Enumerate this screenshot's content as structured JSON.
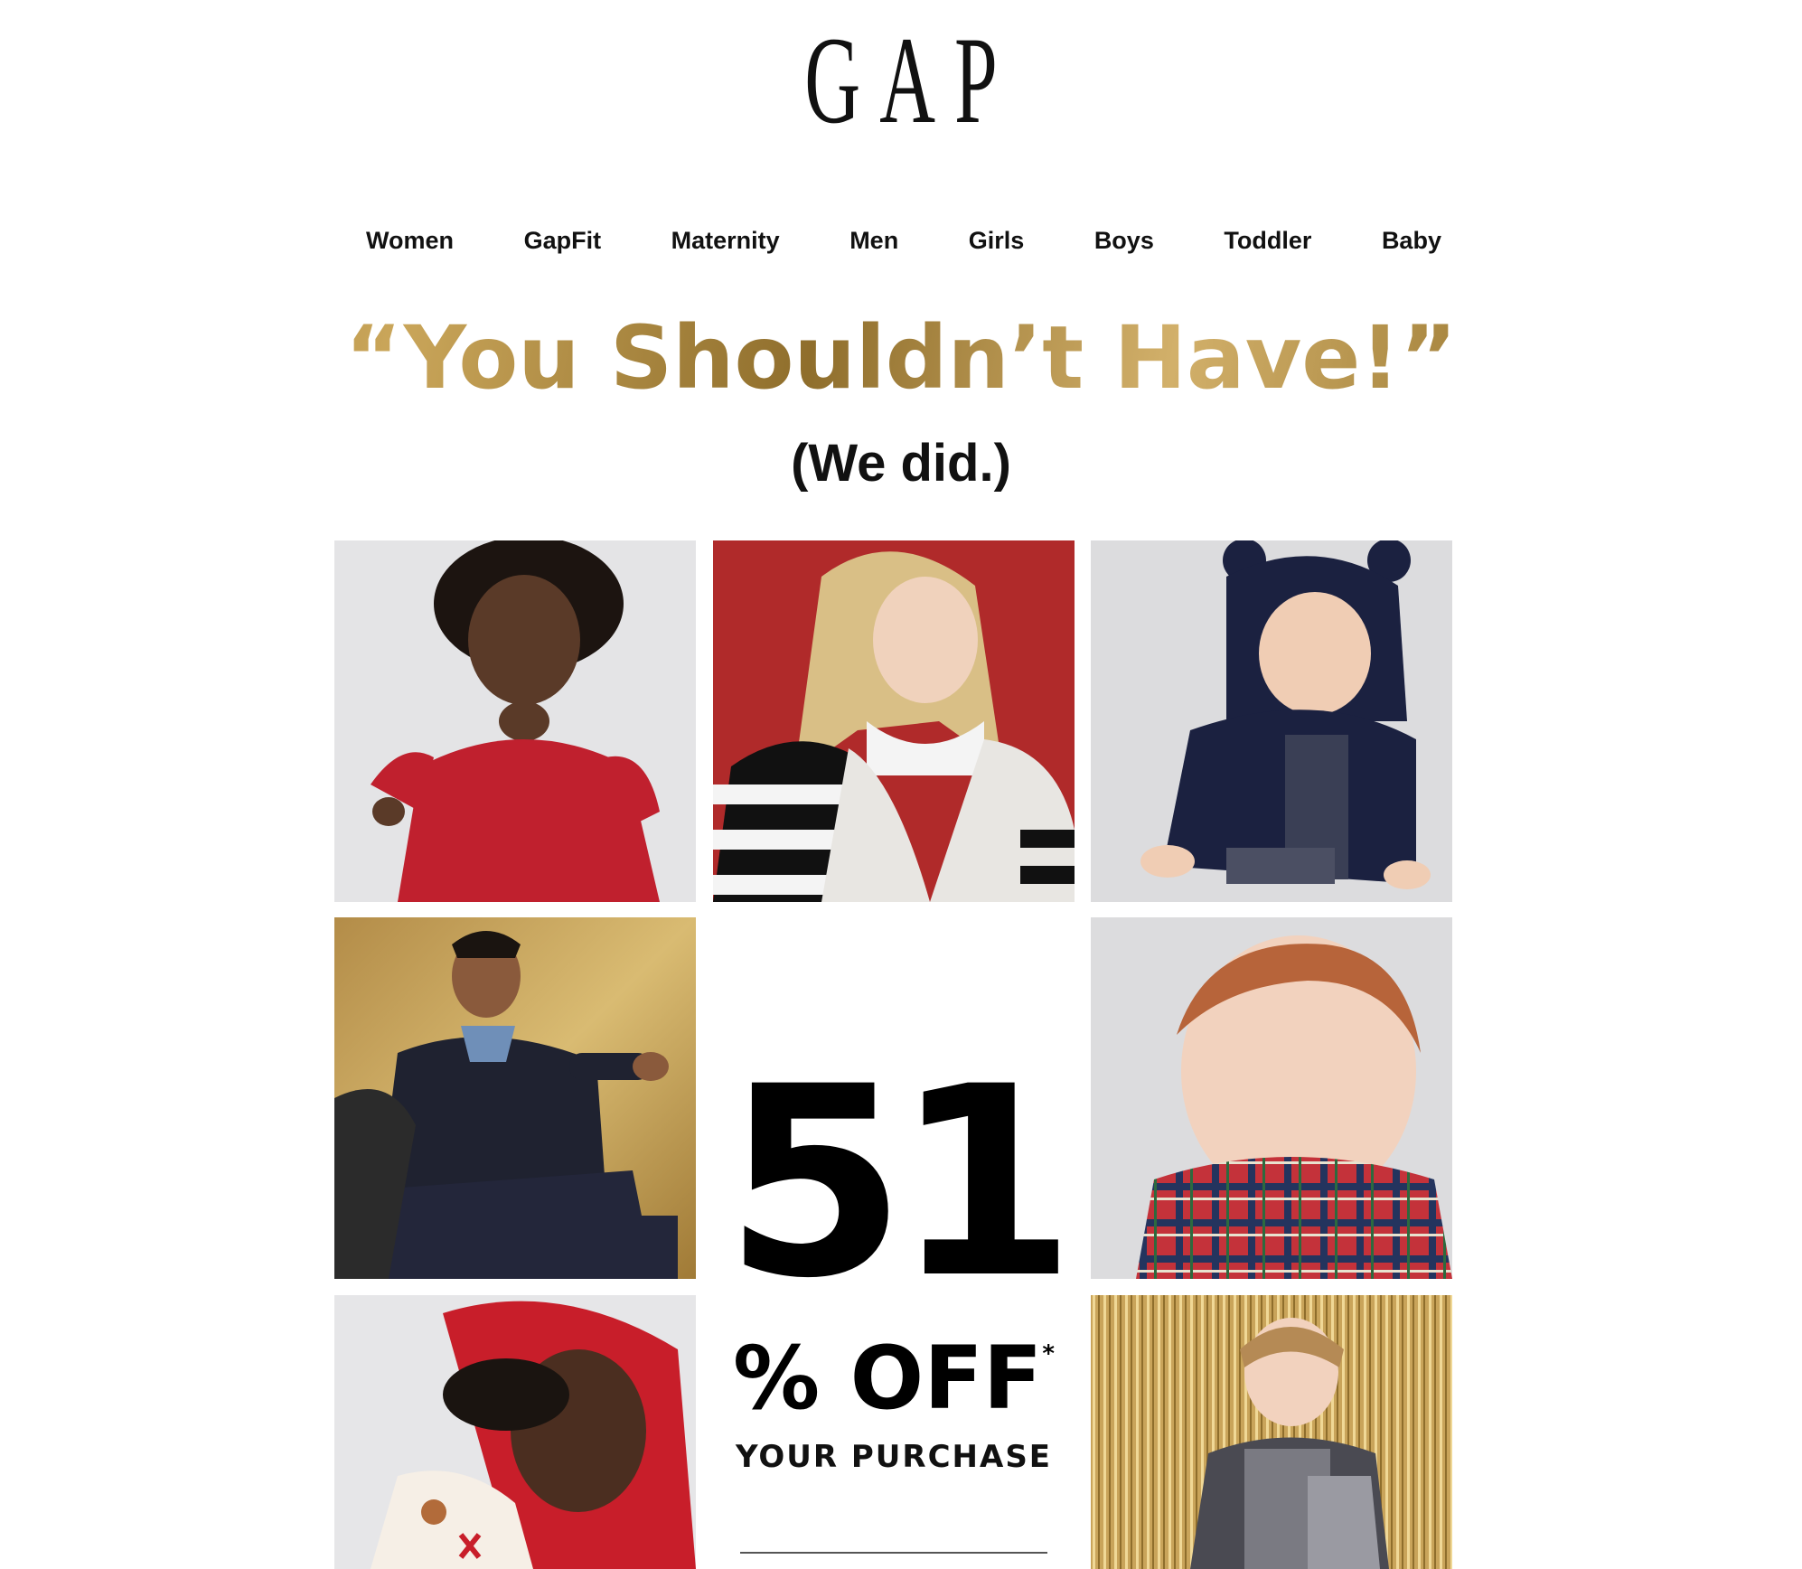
{
  "brand": {
    "logo_text": "GAP"
  },
  "nav": {
    "items": [
      {
        "label": "Women"
      },
      {
        "label": "GapFit"
      },
      {
        "label": "Maternity"
      },
      {
        "label": "Men"
      },
      {
        "label": "Girls"
      },
      {
        "label": "Boys"
      },
      {
        "label": "Toddler"
      },
      {
        "label": "Baby"
      }
    ]
  },
  "hero": {
    "headline": "“You Shouldn’t Have!”",
    "subheadline": "(We did.)"
  },
  "promo": {
    "number": "51",
    "off_text": "% OFF",
    "asterisk": "*",
    "subtext": "YOUR PURCHASE"
  },
  "colors": {
    "headline_gold": "#b08a3e",
    "text": "#111111",
    "background": "#ffffff"
  }
}
